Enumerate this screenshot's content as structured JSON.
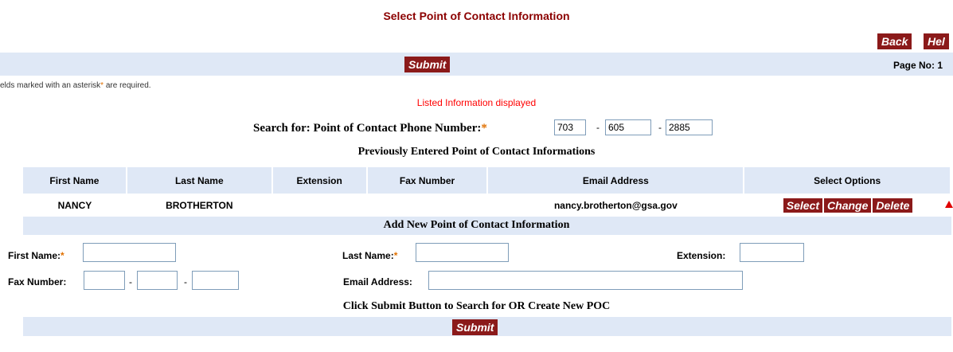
{
  "page": {
    "title": "Select Point of Contact Information",
    "back_label": "Back",
    "help_label": "Hel",
    "submit_label": "Submit",
    "page_no": "Page No: 1",
    "required_note_prefix": "elds marked with an asterisk",
    "required_note_asterisk": "*",
    "required_note_suffix": " are required.",
    "status_message": "Listed Information displayed"
  },
  "search": {
    "label": "Search for: Point of Contact Phone Number:",
    "asterisk": "*",
    "area_code": "703",
    "prefix": "605",
    "line": "2885",
    "dash": "-"
  },
  "previous": {
    "heading": "Previously Entered Point of Contact Informations",
    "columns": [
      "First Name",
      "Last Name",
      "Extension",
      "Fax Number",
      "Email Address",
      "Select Options"
    ],
    "rows": [
      {
        "first_name": "NANCY",
        "last_name": "BROTHERTON",
        "extension": "",
        "fax_number": "",
        "email": "nancy.brotherton@gsa.gov",
        "actions": [
          "Select",
          "Change",
          "Delete"
        ]
      }
    ]
  },
  "add_new": {
    "heading": "Add New Point of Contact Information",
    "first_name_label": "First Name:",
    "last_name_label": "Last Name:",
    "extension_label": "Extension:",
    "fax_label": "Fax Number:",
    "email_label": "Email Address:",
    "asterisk": "*",
    "dash": "-"
  },
  "footer": {
    "instruction": "Click Submit Button to Search for OR Create New POC",
    "submit_label": "Submit"
  },
  "colors": {
    "button_bg": "#8b1a1a",
    "band_bg": "#dfe8f6",
    "title_color": "#8b0000"
  }
}
